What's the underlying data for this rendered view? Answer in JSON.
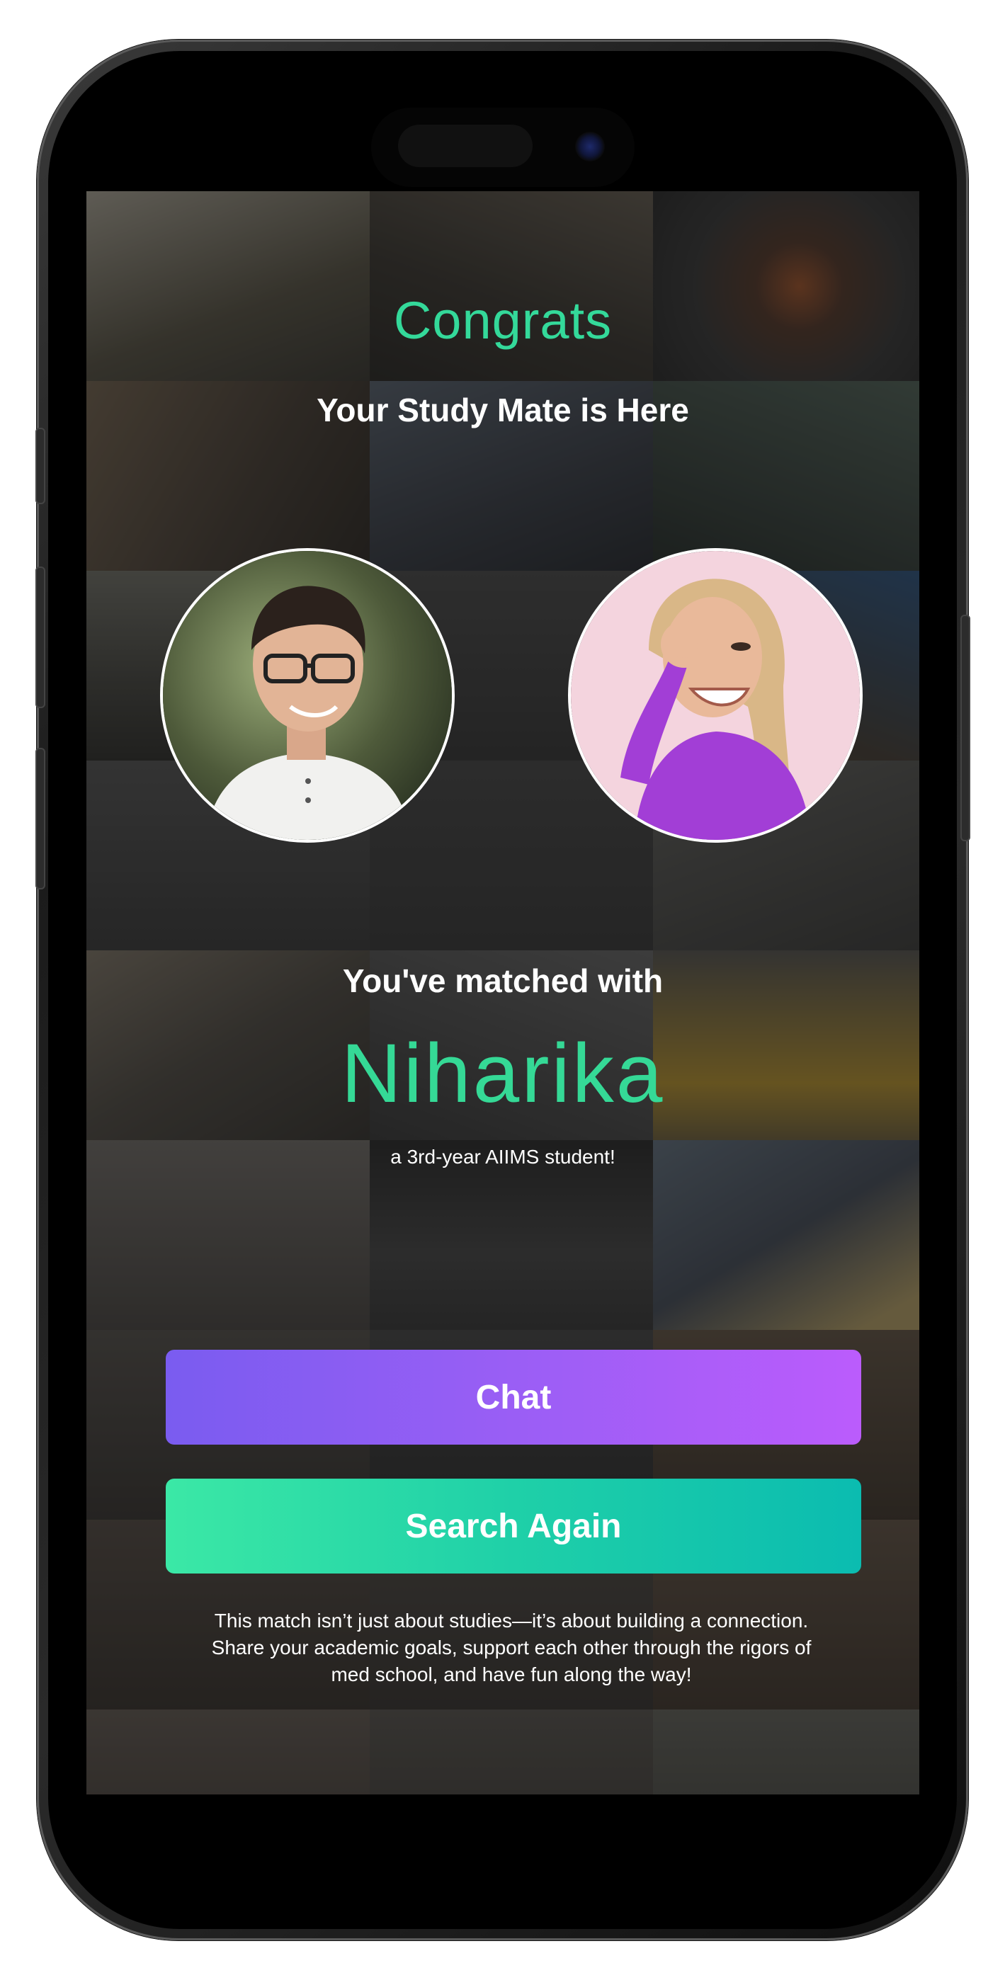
{
  "screen": {
    "title": "Congrats",
    "subtitle": "Your Study Mate is Here",
    "matched_label": "You've matched with",
    "match_name": "Niharika",
    "match_tagline": "a 3rd-year AIIMS student!",
    "buttons": {
      "chat_label": "Chat",
      "search_again_label": "Search Again"
    },
    "footer_text": "This match isn’t just about studies—it’s about building a connection. Share your academic goals, support each other through the rigors of med school, and have fun along the way!"
  },
  "colors": {
    "accent_green": "#35d996",
    "chat_gradient_start": "#7a5cf0",
    "chat_gradient_end": "#bb5cfc",
    "search_gradient_start": "#3be8a6",
    "search_gradient_end": "#0bbcb0"
  },
  "icons": {
    "left_avatar": "user-avatar-photo",
    "right_avatar": "match-avatar-photo"
  }
}
